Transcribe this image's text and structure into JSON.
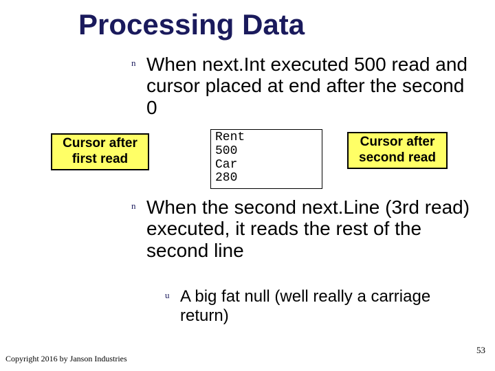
{
  "title": "Processing Data",
  "bullets": {
    "first": {
      "marker": "n",
      "text": "When next.Int executed 500 read and cursor placed at end after the second 0"
    },
    "second": {
      "marker": "n",
      "text": "When the second next.Line (3rd read) executed, it reads the rest of the second line"
    },
    "sub": {
      "marker": "u",
      "text": "A big fat null (well really a carriage return)"
    }
  },
  "boxes": {
    "left": "Cursor after\nfirst read",
    "right": "Cursor after\nsecond read"
  },
  "data_box": {
    "line1": "Rent",
    "line2": "500",
    "line3": "Car",
    "line4": "280"
  },
  "footer": {
    "copyright": "Copyright 2016 by Janson Industries",
    "page": "53"
  }
}
